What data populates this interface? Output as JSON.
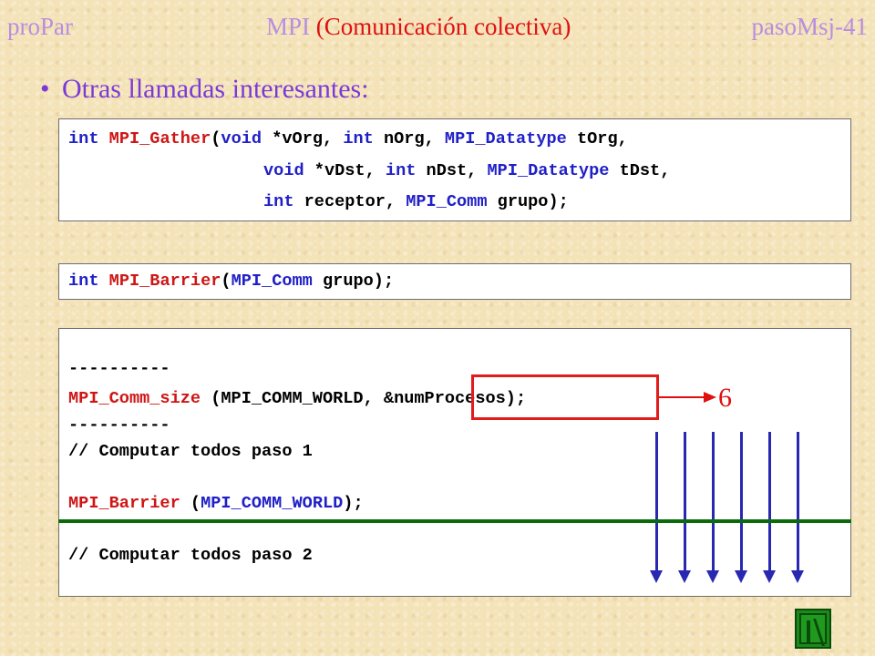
{
  "header": {
    "left": "proPar",
    "center_prefix": "MPI",
    "center_paren": "(Comunicación colectiva)",
    "right": "pasoMsj-41"
  },
  "bullet": {
    "symbol": "•",
    "text": "Otras llamadas interesantes:"
  },
  "code_gather": {
    "l1_kw1": "int",
    "l1_fn": "MPI_Gather",
    "l1_t1": "(",
    "l1_kw2": "void",
    "l1_t2": " *vOrg, ",
    "l1_kw3": "int",
    "l1_t3": " nOrg, ",
    "l1_kw4": "MPI_Datatype",
    "l1_t4": " tOrg,",
    "l2_kw1": "void",
    "l2_t1": " *vDst, ",
    "l2_kw2": "int",
    "l2_t2": " nDst, ",
    "l2_kw3": "MPI_Datatype",
    "l2_t3": " tDst,",
    "l3_kw1": "int",
    "l3_t1": " receptor, ",
    "l3_kw2": "MPI_Comm",
    "l3_t2": " grupo);"
  },
  "code_barrier": {
    "kw1": "int",
    "fn": "MPI_Barrier",
    "t1": "(",
    "kw2": "MPI_Comm",
    "t2": " grupo);"
  },
  "code_example": {
    "dashes1": "----------",
    "l2_fn": "MPI_Comm_size",
    "l2_t1": " (MPI_COMM_WORLD, &numProcesos);",
    "dashes2": "----------",
    "comment1": "// Computar todos paso 1",
    "l5_fn": "MPI_Barrier",
    "l5_t1": " (",
    "l5_kw": "MPI_COMM_WORLD",
    "l5_t2": ");",
    "comment2": "// Computar todos paso 2"
  },
  "annotation": {
    "count": "6"
  },
  "colors": {
    "accent_red": "#e01010",
    "keyword_blue": "#2020c8",
    "separator_green": "#0a6b0a",
    "arrow_blue": "#2828b0"
  }
}
